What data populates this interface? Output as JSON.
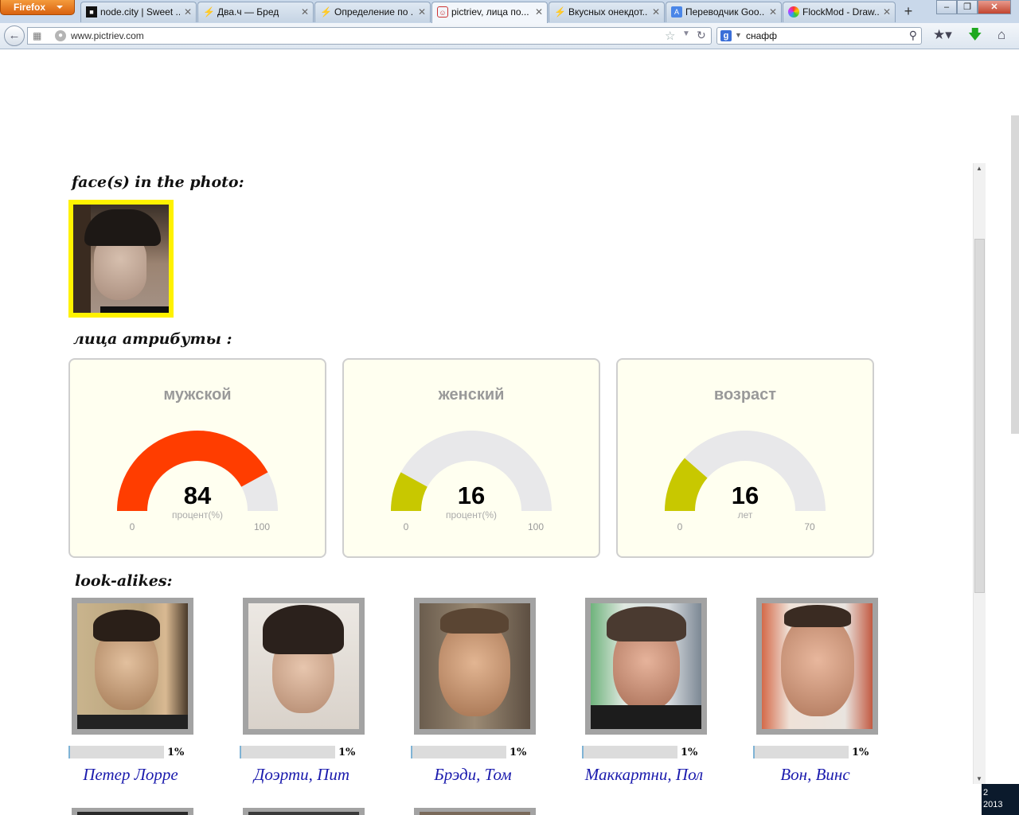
{
  "browser": {
    "menu_button": "Firefox",
    "tabs": [
      {
        "title": "node.city | Sweet ...",
        "icon": "black-square-icon"
      },
      {
        "title": "Два.ч — Бред",
        "icon": "lightning-icon"
      },
      {
        "title": "Определение по ...",
        "icon": "lightning-icon"
      },
      {
        "title": "pictriev, лица по...",
        "icon": "pictriev-icon",
        "active": true
      },
      {
        "title": "Вкусных онекдот...",
        "icon": "lightning-icon"
      },
      {
        "title": "Переводчик Goo...",
        "icon": "translate-icon"
      },
      {
        "title": "FlockMod - Draw...",
        "icon": "flockmod-icon"
      }
    ],
    "url": "www.pictriev.com",
    "search_value": "снафф"
  },
  "page": {
    "faces_heading": "face(s) in the photo:",
    "attributes_heading": "лица атрибуты :",
    "lookalikes_heading": "look-alikes:"
  },
  "gauges": [
    {
      "title": "мужской",
      "value": "84",
      "unit": "процент(%)",
      "min": "0",
      "max": "100",
      "fraction": 0.84,
      "color": "#ff3d00"
    },
    {
      "title": "женский",
      "value": "16",
      "unit": "процент(%)",
      "min": "0",
      "max": "100",
      "fraction": 0.16,
      "color": "#c8c800"
    },
    {
      "title": "возраст",
      "value": "16",
      "unit": "лет",
      "min": "0",
      "max": "70",
      "fraction": 0.2286,
      "color": "#c8c800"
    }
  ],
  "lookalikes": [
    {
      "name": "Петер Лорре",
      "percent": "1%",
      "fraction": 0.01
    },
    {
      "name": "Доэрти, Пит",
      "percent": "1%",
      "fraction": 0.01
    },
    {
      "name": "Брэди, Том",
      "percent": "1%",
      "fraction": 0.01
    },
    {
      "name": "Маккартни, Пол",
      "percent": "1%",
      "fraction": 0.01
    },
    {
      "name": "Вон, Винс",
      "percent": "1%",
      "fraction": 0.01
    }
  ],
  "taskbar": {
    "clock": "2\n2013"
  }
}
